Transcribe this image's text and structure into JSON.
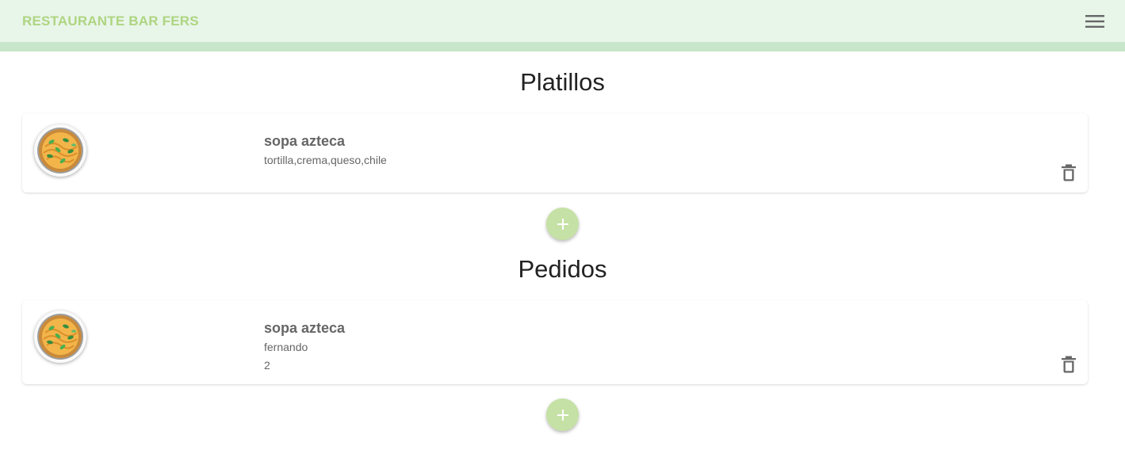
{
  "app": {
    "title": "RESTAURANTE BAR FERS",
    "menu_icon": "menu-icon"
  },
  "colors": {
    "appbar_bg": "#e8f5e9",
    "appbar_strip": "#c8e6c9",
    "title_text": "#aed581",
    "fab_bg": "#c5e1a5"
  },
  "platillos": {
    "title": "Platillos",
    "items": [
      {
        "name": "sopa azteca",
        "ingredients": "tortilla,crema,queso,chile",
        "image_icon": "pasta-bowl-icon",
        "delete_icon": "trash-icon"
      }
    ],
    "add_icon": "plus-icon"
  },
  "pedidos": {
    "title": "Pedidos",
    "items": [
      {
        "name": "sopa azteca",
        "customer": "fernando",
        "quantity": "2",
        "image_icon": "pasta-bowl-icon",
        "delete_icon": "trash-icon"
      }
    ],
    "add_icon": "plus-icon"
  }
}
